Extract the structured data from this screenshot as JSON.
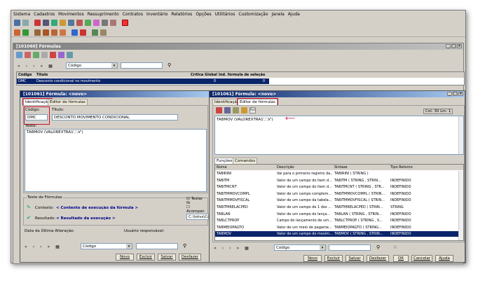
{
  "menu": [
    "Sistema",
    "Cadastros",
    "Movimentos",
    "Ressuprimento",
    "Contratos",
    "Inventário",
    "Relatórios",
    "Opções",
    "Utilitários",
    "Customização",
    "Janela",
    "Ajuda"
  ],
  "formulas_window": {
    "title": "[101060] Fórmulas",
    "search_field": "Código",
    "columns": [
      "Código",
      "Título",
      "Crítica Global",
      "Ind. fórmula de seleção"
    ],
    "row": {
      "code": "DMC",
      "title": "Desconto condicional no movimento",
      "critica": "0",
      "ind": "0"
    }
  },
  "left": {
    "title": "[101061] Fórmula: <novo>",
    "tabs": [
      "Identificação",
      "Editor de fórmulas"
    ],
    "code_label": "Código:",
    "code_value": "DMC",
    "title_label": "Título:",
    "title_value": "DESCONTO MOVIMENTO CONDICIONAL",
    "text_label": "Texto:",
    "text_value": "TABMOV (VALOREXTRA1',',V')",
    "test_group": "Teste de Fórmulas",
    "context_label": "Contexto:",
    "context_value": "< Contexto de execução da fórmula >",
    "result_label": "Resultado:",
    "result_value": "< Resultado da execução >",
    "testar": "Testar fó",
    "acompanhar": "Acompan",
    "path": "C:\\totvs\\Co",
    "last_change": "Data da Última Alteração:",
    "responsible": "Usuário responsável:",
    "search_field": "Código",
    "buttons": [
      "Novo",
      "Excluir",
      "Salvar",
      "Desfazer"
    ]
  },
  "right": {
    "title": "[101061] Fórmula: <novo>",
    "tabs": [
      "Identificação",
      "Editor de fórmulas"
    ],
    "position": "Col: 30  Lin: 1",
    "editor_text": "TABMOV (VALOREXTRA1',',V')",
    "sub_tabs": [
      "Funções",
      "Comandos"
    ],
    "columns": [
      "Nome",
      "Descrição",
      "Sintaxe",
      "Tipo Retorno"
    ],
    "rows": [
      [
        "TABIRINI",
        "Vai para o primeiro registro da...",
        "TABIRINI ( STRING )",
        ""
      ],
      [
        "TABITM",
        "Valor de um campo do item d...",
        "TABITM ( STRING , STRIN...",
        "INDEFINIDO"
      ],
      [
        "TABITMCNT",
        "Valor de um campo do item d...",
        "TABITMCNT ( STRING , STR...",
        "INDEFINIDO"
      ],
      [
        "TABITMMOVCOMPL",
        "Valor de um campo complem...",
        "TABITMMOVCOMPL ( STRIN...",
        "INDEFINIDO"
      ],
      [
        "TABITMMOVFISCAL",
        "Valor de um campo da tabela...",
        "TABITMMOVFISCAL ( STRIN...",
        "INDEFINIDO"
      ],
      [
        "TABITMRELACPED",
        "Valor de um campo de 1 dos ...",
        "TABITMRELACPED ( STRIN...",
        "STRING"
      ],
      [
        "TABLAN",
        "Valor de um campo do lança...",
        "TABLAN ( STRING , STRIN...",
        "INDEFINIDO"
      ],
      [
        "TABLCTPROP",
        "Campo do lançamento de um...",
        "TABLCTPROP ( STRING , S...",
        "INDEFINIDO"
      ],
      [
        "TABMEIOPAGTO",
        "Valor de um meio de pagame...",
        "TABMEIOPAGTO ( STRING...",
        "INDEFINIDO"
      ],
      [
        "TABMOV",
        "Valor de um campo do movim...",
        "TABMOV ( STRING , STRIN...",
        "INDEFINIDO"
      ]
    ],
    "search_field": "Código",
    "buttons": [
      "Novo",
      "Excluir",
      "Salvar",
      "Desfazer",
      "OK",
      "Cancelar",
      "Ajuda"
    ]
  },
  "colors": {
    "title_active": "#0a246a",
    "highlight": "#c8102e",
    "selected_row": "#0a246a"
  }
}
